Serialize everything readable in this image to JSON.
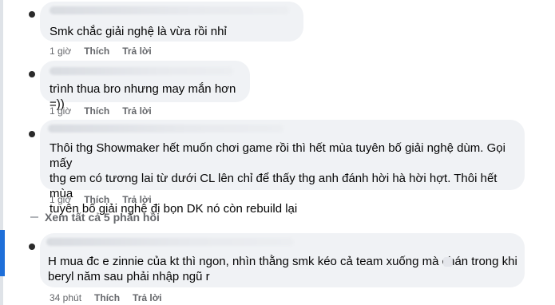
{
  "comments": [
    {
      "text": "Smk chắc giải nghệ là vừa rồi nhỉ",
      "time": "1 giờ",
      "like": "Thích",
      "reply": "Trả lời"
    },
    {
      "text": "trình thua bro nhưng may mắn hơn =))",
      "time": "1 giờ",
      "like": "Thích",
      "reply": "Trả lời"
    },
    {
      "text": "Thôi thg Showmaker hết muốn chơi game rồi thì hết mùa tuyên bố giải nghệ dùm. Gọi mấy\nthg em có tương lai từ dưới CL lên chỉ để thấy thg anh đánh hời hà hời hợt. Thôi hết mùa\ntuyên bố giải nghệ đi bọn DK nó còn rebuild lại",
      "time": "1 giờ",
      "like": "Thích",
      "reply": "Trả lời"
    },
    {
      "text": "H mua đc e zinnie của kt thì ngon, nhìn thằng smk kéo cả team xuống mà chán     trong khi\nberyl năm sau phải nhập ngũ r",
      "time": "34 phút",
      "like": "Thích",
      "reply": "Trả lời"
    }
  ],
  "view_more": "Xem tất cả 5 phản hồi",
  "colors": {
    "bubble_bg": "#f0f2f5",
    "meta_text": "#65676b",
    "accent_blue": "#1e6fd9"
  }
}
